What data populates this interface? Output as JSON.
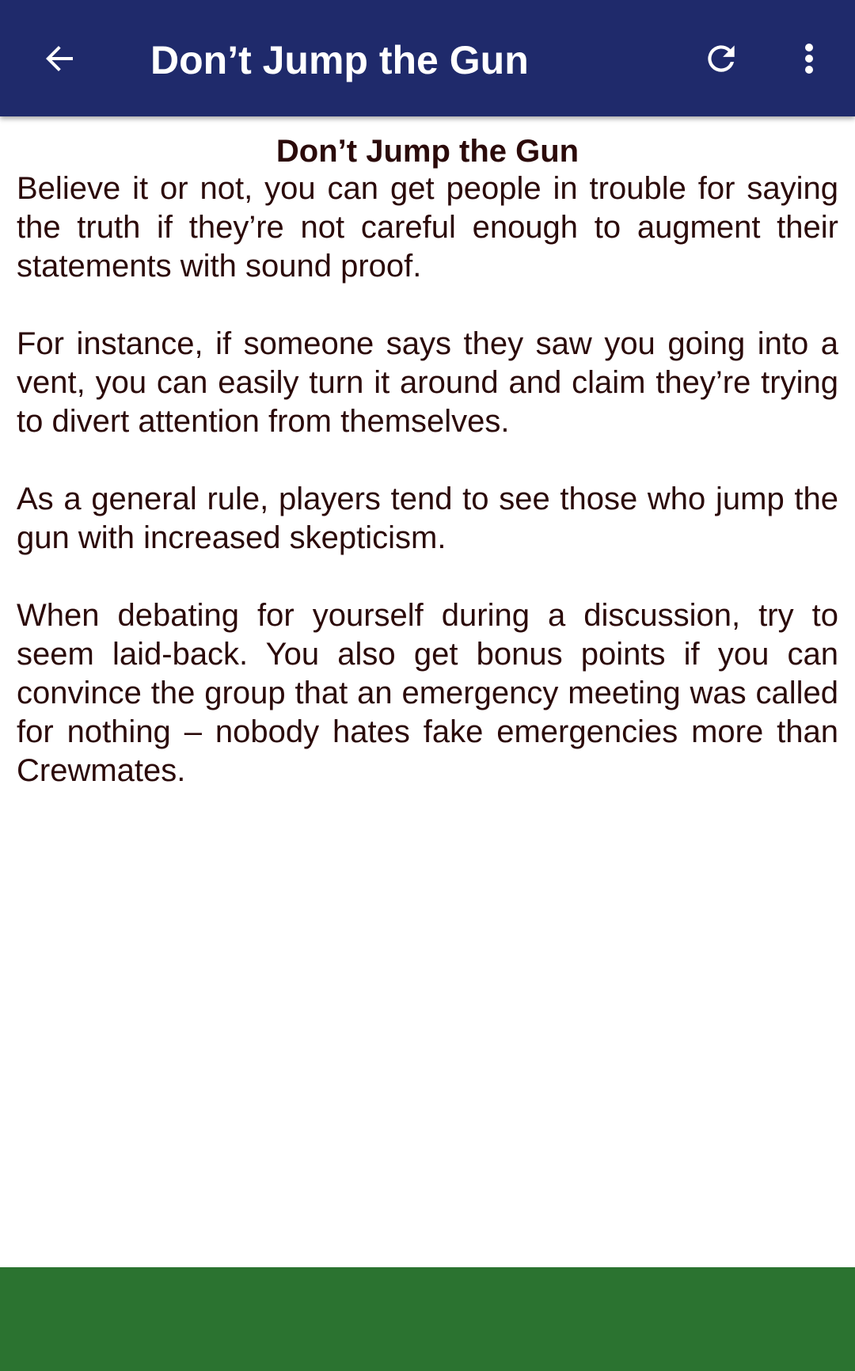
{
  "app_bar": {
    "title": "Don’t Jump the Gun",
    "back_icon": "arrow-back-icon",
    "refresh_icon": "refresh-icon",
    "menu_icon": "more-vert-icon",
    "background_color": "#1f2a6b"
  },
  "article": {
    "title": "Don’t Jump the Gun",
    "paragraphs": [
      "Believe it or not, you can get people in trouble for saying the truth if they’re not careful enough to augment their statements with sound proof.",
      "For instance, if someone says they saw you going into a vent, you can easily turn it around and claim they’re trying to divert attention from themselves.",
      "As a general rule, players tend to see those who jump the gun with increased skepticism.",
      "When debating for yourself during a discussion, try to seem laid-back. You also get bonus points if you can convince the group that an emergency meeting was called for nothing – nobody hates fake emergencies more than Crewmates."
    ],
    "text_color": "#2b0a0a"
  },
  "footer": {
    "background_color": "#2b7330"
  }
}
